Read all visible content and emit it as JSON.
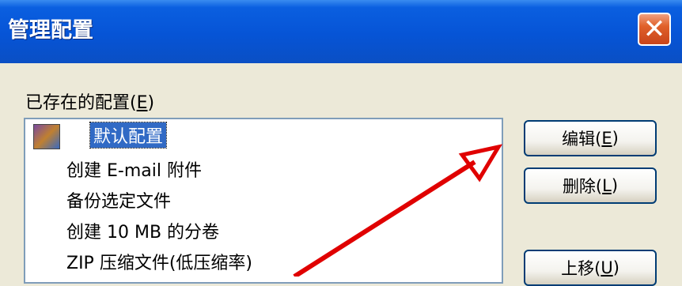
{
  "window": {
    "title": "管理配置",
    "close_icon": "close-icon"
  },
  "list": {
    "label_text": "已存在的配置(",
    "label_key": "E",
    "label_close": ")",
    "items": [
      "默认配置",
      "创建 E-mail 附件",
      "备份选定文件",
      "创建 10 MB 的分卷",
      "ZIP 压缩文件(低压缩率)"
    ],
    "selected_index": 0
  },
  "buttons": {
    "edit": {
      "text": "编辑(",
      "key": "E",
      "close": ")"
    },
    "delete": {
      "text": "删除(",
      "key": "L",
      "close": ")"
    },
    "move_up": {
      "text": "上移(",
      "key": "U",
      "close": ")"
    }
  },
  "colors": {
    "titlebar": "#0654d6",
    "selection": "#316ac5",
    "arrow": "#e00000"
  }
}
